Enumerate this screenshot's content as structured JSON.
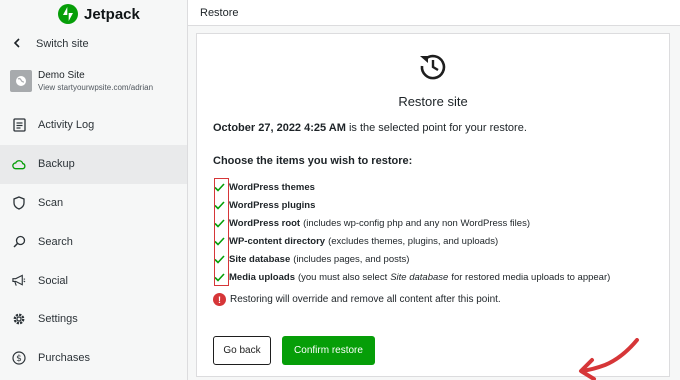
{
  "app": {
    "brand": "Jetpack",
    "header_title": "Restore"
  },
  "sidebar": {
    "switch_site": "Switch site",
    "site": {
      "name": "Demo Site",
      "url": "View startyourwpsite.com/adrian"
    },
    "items": [
      {
        "label": "Activity Log",
        "icon": "activity-log-icon"
      },
      {
        "label": "Backup",
        "icon": "cloud-icon",
        "active": true
      },
      {
        "label": "Scan",
        "icon": "shield-icon"
      },
      {
        "label": "Search",
        "icon": "search-icon"
      },
      {
        "label": "Social",
        "icon": "megaphone-icon"
      },
      {
        "label": "Settings",
        "icon": "gear-icon"
      },
      {
        "label": "Purchases",
        "icon": "dollar-icon"
      }
    ]
  },
  "restore": {
    "title": "Restore site",
    "point_date": "October 27, 2022 4:25 AM",
    "point_suffix": "is the selected point for your restore.",
    "choose_label": "Choose the items you wish to restore:",
    "items": [
      {
        "label": "WordPress themes",
        "desc": "",
        "checked": true
      },
      {
        "label": "WordPress plugins",
        "desc": "",
        "checked": true
      },
      {
        "label": "WordPress root",
        "desc": "(includes wp-config php and any non WordPress files)",
        "checked": true
      },
      {
        "label": "WP-content directory",
        "desc": "(excludes themes, plugins, and uploads)",
        "checked": true
      },
      {
        "label": "Site database",
        "desc": "(includes pages, and posts)",
        "checked": true
      },
      {
        "label": "Media uploads",
        "desc_before": "(you must also select",
        "desc_em": "Site database",
        "desc_after": "for restored media uploads to appear)",
        "checked": true
      }
    ],
    "warning": "Restoring will override and remove all content after this point.",
    "back_label": "Go back",
    "confirm_label": "Confirm restore"
  },
  "colors": {
    "accent": "#069e08",
    "warning": "#d63638",
    "annotation": "#d63638"
  }
}
